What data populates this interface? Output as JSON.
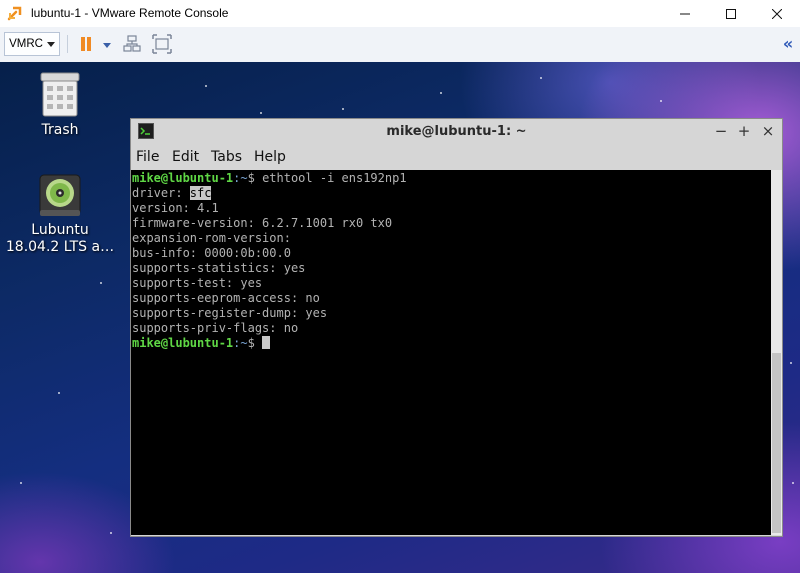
{
  "window": {
    "title": "lubuntu-1 - VMware Remote Console",
    "controls": {
      "minimize": "—",
      "maximize": "☐",
      "close": "✕"
    }
  },
  "toolbar": {
    "vmrc_label": "VMRC",
    "pause_color": "#f08a24",
    "collapse_glyph": "«"
  },
  "desktop": {
    "icons": [
      {
        "label": "Trash",
        "icon": "trash-icon"
      },
      {
        "label": "Lubuntu\n18.04.2 LTS a…",
        "label_line1": "Lubuntu",
        "label_line2": "18.04.2 LTS a…",
        "icon": "cd-drive-icon"
      }
    ]
  },
  "terminal": {
    "title": "mike@lubuntu-1: ~",
    "controls": {
      "minimize": "−",
      "maximize": "+",
      "close": "×"
    },
    "menu": [
      "File",
      "Edit",
      "Tabs",
      "Help"
    ],
    "prompt_user": "mike@lubuntu-1",
    "prompt_path": ":~",
    "prompt_symbol": "$ ",
    "command": "ethtool -i ens192np1",
    "driver_label": "driver: ",
    "driver_value": "sfc",
    "output": [
      "version: 4.1",
      "firmware-version: 6.2.7.1001 rx0 tx0",
      "expansion-rom-version:",
      "bus-info: 0000:0b:00.0",
      "supports-statistics: yes",
      "supports-test: yes",
      "supports-eeprom-access: no",
      "supports-register-dump: yes",
      "supports-priv-flags: no"
    ],
    "colors": {
      "user": "#5fd745",
      "path": "#7aa5d4",
      "text": "#b3b3b3",
      "background": "#000000"
    }
  }
}
